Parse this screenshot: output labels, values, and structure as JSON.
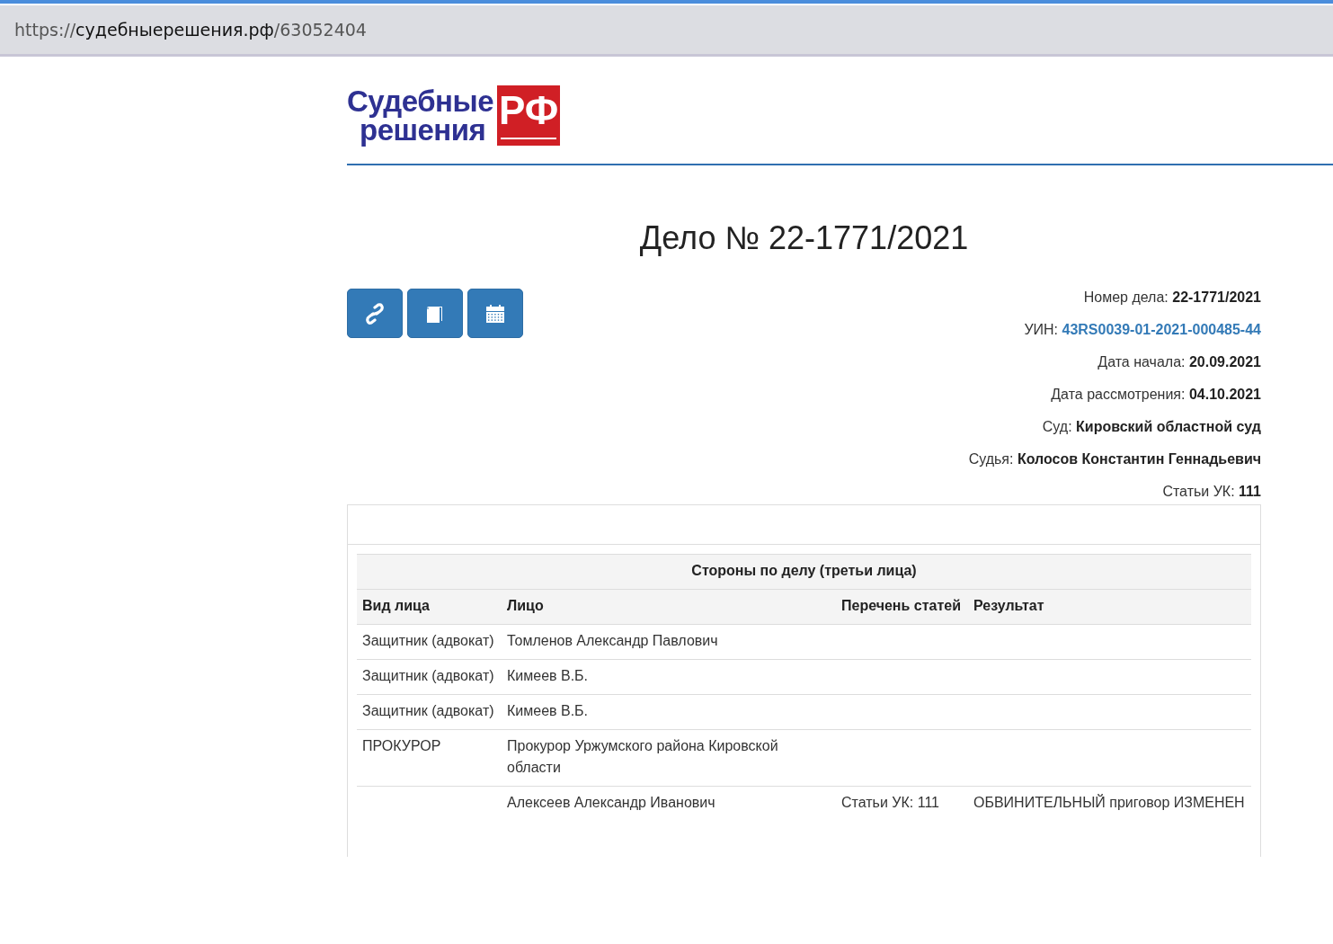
{
  "address_bar": {
    "scheme": "https://",
    "host": "судебныерешения.рф",
    "path": "/63052404"
  },
  "logo": {
    "line_1": "Судебные",
    "line_2": "решения",
    "badge": "РФ"
  },
  "title": "Дело № 22-1771/2021",
  "action_buttons": [
    {
      "kind": "link"
    },
    {
      "kind": "book"
    },
    {
      "kind": "calendar"
    }
  ],
  "case_info": [
    {
      "label": "Номер дела:",
      "value": "22-1771/2021",
      "kind": "text"
    },
    {
      "label": "УИН:",
      "value": "43RS0039-01-2021-000485-44",
      "kind": "link"
    },
    {
      "label": "Дата начала:",
      "value": "20.09.2021",
      "kind": "text"
    },
    {
      "label": "Дата рассмотрения:",
      "value": "04.10.2021",
      "kind": "text"
    },
    {
      "label": "Суд:",
      "value": "Кировский областной суд",
      "kind": "text"
    },
    {
      "label": "Судья:",
      "value": "Колосов Константин Геннадьевич",
      "kind": "text"
    },
    {
      "label": "Статьи УК:",
      "value": "111",
      "kind": "text"
    }
  ],
  "parties_table": {
    "caption": "Стороны по делу (третьи лица)",
    "columns": [
      "Вид лица",
      "Лицо",
      "Перечень статей",
      "Результат"
    ],
    "rows": [
      [
        "Защитник (адвокат)",
        "Томленов Александр Павлович",
        "",
        ""
      ],
      [
        "Защитник (адвокат)",
        "Кимеев В.Б.",
        "",
        ""
      ],
      [
        "Защитник (адвокат)",
        "Кимеев В.Б.",
        "",
        ""
      ],
      [
        "ПРОКУРОР",
        "Прокурор Уржумского района Кировской области",
        "",
        ""
      ],
      [
        "",
        "Алексеев Александр Иванович",
        "Статьи УК: 111",
        "ОБВИНИТЕЛЬНЫЙ приговор ИЗМЕНЕН"
      ]
    ]
  }
}
